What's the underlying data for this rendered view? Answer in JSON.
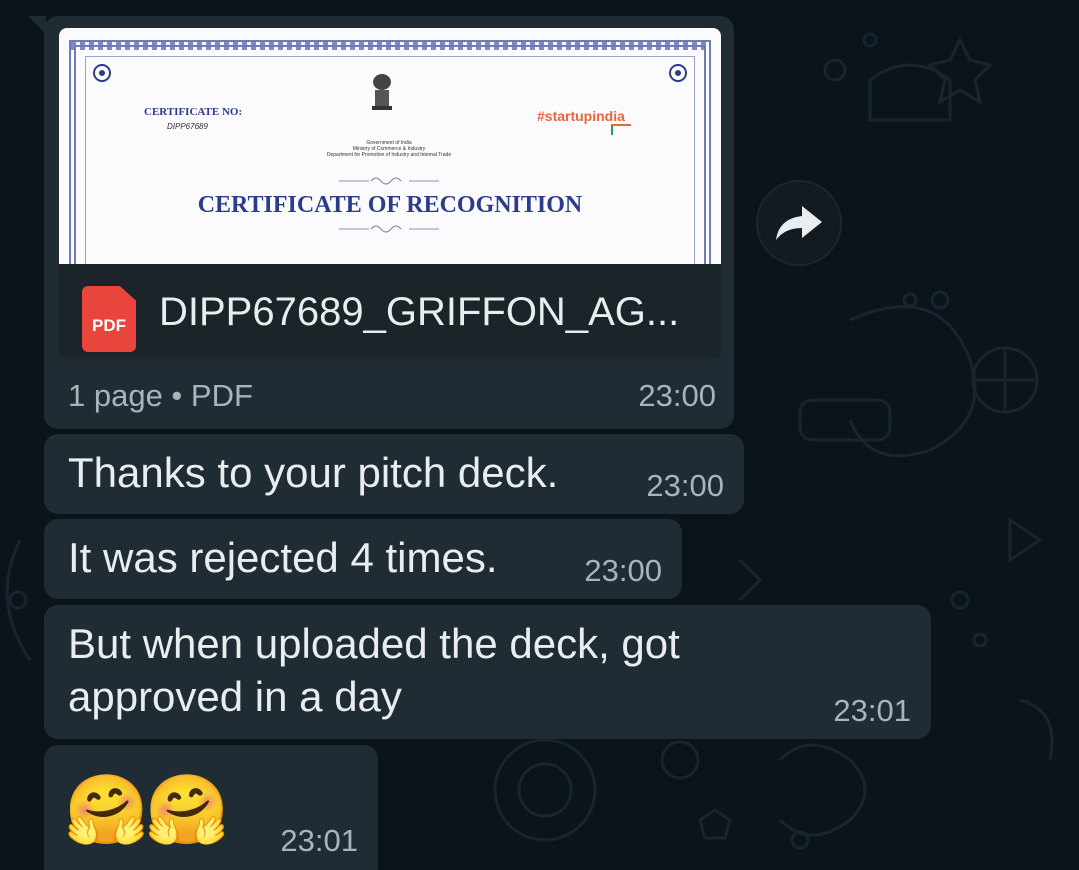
{
  "doc_message": {
    "file_name": "DIPP67689_GRIFFON_AG...",
    "file_type_badge": "PDF",
    "meta": "1 page • PDF",
    "time": "23:00",
    "preview": {
      "cert_no_label": "CERTIFICATE NO:",
      "cert_no_value": "DIPP67689",
      "gov_line1": "Government of India",
      "gov_line2": "Ministry of Commerce & Industry",
      "gov_line3": "Department for Promotion of Industry and Internal Trade",
      "brand": "#startupindia",
      "title": "CERTIFICATE OF RECOGNITION"
    }
  },
  "messages": [
    {
      "text": "Thanks to your pitch deck.",
      "time": "23:00"
    },
    {
      "text": "It was rejected 4 times.",
      "time": "23:00"
    },
    {
      "text_line1": "But when uploaded the deck, got",
      "text_line2": "approved in a day",
      "time": "23:01"
    },
    {
      "emoji": "🤗🤗",
      "time": "23:01"
    }
  ],
  "colors": {
    "background": "#0b141a",
    "bubble": "#202c33",
    "text": "#e9edef",
    "timestamp": "#a8b3ba",
    "pdf_badge": "#e8453c"
  },
  "icons": {
    "forward": "forward-arrow-icon",
    "pdf": "pdf-file-icon"
  }
}
